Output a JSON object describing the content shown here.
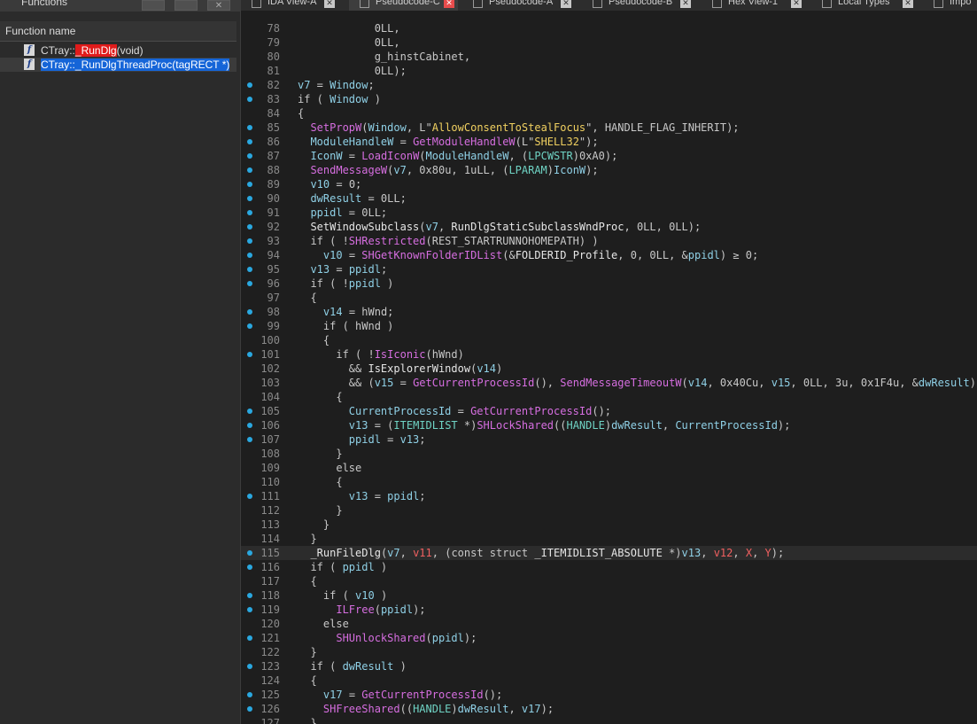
{
  "left_panel": {
    "title": "Functions",
    "header": "Function name",
    "buttons": [
      "",
      "",
      "✕"
    ],
    "items": [
      {
        "prefix": "CTray::",
        "highlight": "_RunDlg",
        "suffix": "(void)"
      },
      {
        "text": "CTray::_RunDlgThreadProc(tagRECT *)"
      }
    ]
  },
  "tabs": [
    {
      "label": "IDA View-A",
      "close": "✕"
    },
    {
      "label": "Pseudocode-C",
      "close": "✕"
    },
    {
      "label": "Pseudocode-A",
      "close": "✕"
    },
    {
      "label": "Pseudocode-B",
      "close": "✕"
    },
    {
      "label": "Hex View-1",
      "close": "✕"
    },
    {
      "label": "Local Types",
      "close": "✕"
    },
    {
      "label": "Impo"
    }
  ],
  "colors": {
    "background": "#1e1e1e",
    "line_dot": "#2aa8e0",
    "variable": "#8fd0e6",
    "function": "#d66ee0",
    "string": "#f0d060",
    "register": "#f06060",
    "type": "#6fd3c4"
  },
  "code_lines": [
    {
      "n": "78",
      "dot": false,
      "code": [
        [
          "            0LL,",
          "k"
        ]
      ]
    },
    {
      "n": "79",
      "dot": false,
      "code": [
        [
          "            0LL,",
          "k"
        ]
      ]
    },
    {
      "n": "80",
      "dot": false,
      "code": [
        [
          "            g_hinstCabinet,",
          "k"
        ]
      ]
    },
    {
      "n": "81",
      "dot": false,
      "code": [
        [
          "            0LL);",
          "k"
        ]
      ]
    },
    {
      "n": "82",
      "dot": true,
      "code": [
        [
          "v7",
          "v"
        ],
        [
          " = ",
          "k"
        ],
        [
          "Window",
          "v"
        ],
        [
          ";",
          "k"
        ]
      ]
    },
    {
      "n": "83",
      "dot": true,
      "code": [
        [
          "if ( ",
          "k"
        ],
        [
          "Window",
          "v"
        ],
        [
          " )",
          "k"
        ]
      ]
    },
    {
      "n": "84",
      "dot": false,
      "code": [
        [
          "{",
          "k"
        ]
      ]
    },
    {
      "n": "85",
      "dot": true,
      "code": [
        [
          "  ",
          "k"
        ],
        [
          "SetPropW",
          "f"
        ],
        [
          "(",
          "k"
        ],
        [
          "Window",
          "v"
        ],
        [
          ", L\"",
          "k"
        ],
        [
          "AllowConsentToStealFocus",
          "s"
        ],
        [
          "\", HANDLE_FLAG_INHERIT);",
          "k"
        ]
      ]
    },
    {
      "n": "86",
      "dot": true,
      "code": [
        [
          "  ",
          "k"
        ],
        [
          "ModuleHandleW",
          "v"
        ],
        [
          " = ",
          "k"
        ],
        [
          "GetModuleHandleW",
          "f"
        ],
        [
          "(L\"",
          "k"
        ],
        [
          "SHELL32",
          "s"
        ],
        [
          "\");",
          "k"
        ]
      ]
    },
    {
      "n": "87",
      "dot": true,
      "code": [
        [
          "  ",
          "k"
        ],
        [
          "IconW",
          "v"
        ],
        [
          " = ",
          "k"
        ],
        [
          "LoadIconW",
          "f"
        ],
        [
          "(",
          "k"
        ],
        [
          "ModuleHandleW",
          "v"
        ],
        [
          ", (",
          "k"
        ],
        [
          "LPCWSTR",
          "ty"
        ],
        [
          ")0xA0);",
          "k"
        ]
      ]
    },
    {
      "n": "88",
      "dot": true,
      "code": [
        [
          "  ",
          "k"
        ],
        [
          "SendMessageW",
          "f"
        ],
        [
          "(",
          "k"
        ],
        [
          "v7",
          "v"
        ],
        [
          ", 0x80u, 1uLL, (",
          "k"
        ],
        [
          "LPARAM",
          "ty"
        ],
        [
          ")",
          "k"
        ],
        [
          "IconW",
          "v"
        ],
        [
          ");",
          "k"
        ]
      ]
    },
    {
      "n": "89",
      "dot": true,
      "code": [
        [
          "  ",
          "k"
        ],
        [
          "v10",
          "v"
        ],
        [
          " = 0;",
          "k"
        ]
      ]
    },
    {
      "n": "90",
      "dot": true,
      "code": [
        [
          "  ",
          "k"
        ],
        [
          "dwResult",
          "v"
        ],
        [
          " = 0LL;",
          "k"
        ]
      ]
    },
    {
      "n": "91",
      "dot": true,
      "code": [
        [
          "  ",
          "k"
        ],
        [
          "ppidl",
          "v"
        ],
        [
          " = 0LL;",
          "k"
        ]
      ]
    },
    {
      "n": "92",
      "dot": true,
      "code": [
        [
          "  ",
          "k"
        ],
        [
          "SetWindowSubclass",
          "fw"
        ],
        [
          "(",
          "k"
        ],
        [
          "v7",
          "v"
        ],
        [
          ", ",
          "k"
        ],
        [
          "RunDlgStaticSubclassWndProc",
          "fw"
        ],
        [
          ", 0LL, 0LL);",
          "k"
        ]
      ]
    },
    {
      "n": "93",
      "dot": true,
      "code": [
        [
          "  if ( !",
          "k"
        ],
        [
          "SHRestricted",
          "f"
        ],
        [
          "(REST_STARTRUNNOHOMEPATH) )",
          "k"
        ]
      ]
    },
    {
      "n": "94",
      "dot": true,
      "code": [
        [
          "    ",
          "k"
        ],
        [
          "v10",
          "v"
        ],
        [
          " = ",
          "k"
        ],
        [
          "SHGetKnownFolderIDList",
          "f"
        ],
        [
          "(&",
          "k"
        ],
        [
          "FOLDERID_Profile",
          "fw"
        ],
        [
          ", 0, 0LL, &",
          "k"
        ],
        [
          "ppidl",
          "v"
        ],
        [
          ") ≥ 0;",
          "k"
        ]
      ]
    },
    {
      "n": "95",
      "dot": true,
      "code": [
        [
          "  ",
          "k"
        ],
        [
          "v13",
          "v"
        ],
        [
          " = ",
          "k"
        ],
        [
          "ppidl",
          "v"
        ],
        [
          ";",
          "k"
        ]
      ]
    },
    {
      "n": "96",
      "dot": true,
      "code": [
        [
          "  if ( !",
          "k"
        ],
        [
          "ppidl",
          "v"
        ],
        [
          " )",
          "k"
        ]
      ]
    },
    {
      "n": "97",
      "dot": false,
      "code": [
        [
          "  {",
          "k"
        ]
      ]
    },
    {
      "n": "98",
      "dot": true,
      "code": [
        [
          "    ",
          "k"
        ],
        [
          "v14",
          "v"
        ],
        [
          " = hWnd;",
          "k"
        ]
      ]
    },
    {
      "n": "99",
      "dot": true,
      "code": [
        [
          "    if ( hWnd )",
          "k"
        ]
      ]
    },
    {
      "n": "100",
      "dot": false,
      "code": [
        [
          "    {",
          "k"
        ]
      ]
    },
    {
      "n": "101",
      "dot": true,
      "code": [
        [
          "      if ( !",
          "k"
        ],
        [
          "IsIconic",
          "f"
        ],
        [
          "(hWnd)",
          "k"
        ]
      ]
    },
    {
      "n": "102",
      "dot": false,
      "code": [
        [
          "        && ",
          "k"
        ],
        [
          "IsExplorerWindow",
          "fw"
        ],
        [
          "(",
          "k"
        ],
        [
          "v14",
          "v"
        ],
        [
          ")",
          "k"
        ]
      ]
    },
    {
      "n": "103",
      "dot": false,
      "code": [
        [
          "        && (",
          "k"
        ],
        [
          "v15",
          "v"
        ],
        [
          " = ",
          "k"
        ],
        [
          "GetCurrentProcessId",
          "f"
        ],
        [
          "(), ",
          "k"
        ],
        [
          "SendMessageTimeoutW",
          "f"
        ],
        [
          "(",
          "k"
        ],
        [
          "v14",
          "v"
        ],
        [
          ", 0x40Cu, ",
          "k"
        ],
        [
          "v15",
          "v"
        ],
        [
          ", 0LL, 3u, 0x1F4u, &",
          "k"
        ],
        [
          "dwResult",
          "v"
        ],
        [
          "), dw",
          "k"
        ]
      ]
    },
    {
      "n": "104",
      "dot": false,
      "code": [
        [
          "      {",
          "k"
        ]
      ]
    },
    {
      "n": "105",
      "dot": true,
      "code": [
        [
          "        ",
          "k"
        ],
        [
          "CurrentProcessId",
          "v"
        ],
        [
          " = ",
          "k"
        ],
        [
          "GetCurrentProcessId",
          "f"
        ],
        [
          "();",
          "k"
        ]
      ]
    },
    {
      "n": "106",
      "dot": true,
      "code": [
        [
          "        ",
          "k"
        ],
        [
          "v13",
          "v"
        ],
        [
          " = (",
          "k"
        ],
        [
          "ITEMIDLIST",
          "ty"
        ],
        [
          " *)",
          "k"
        ],
        [
          "SHLockShared",
          "f"
        ],
        [
          "((",
          "k"
        ],
        [
          "HANDLE",
          "ty"
        ],
        [
          ")",
          "k"
        ],
        [
          "dwResult",
          "v"
        ],
        [
          ", ",
          "k"
        ],
        [
          "CurrentProcessId",
          "v"
        ],
        [
          ");",
          "k"
        ]
      ]
    },
    {
      "n": "107",
      "dot": true,
      "code": [
        [
          "        ",
          "k"
        ],
        [
          "ppidl",
          "v"
        ],
        [
          " = ",
          "k"
        ],
        [
          "v13",
          "v"
        ],
        [
          ";",
          "k"
        ]
      ]
    },
    {
      "n": "108",
      "dot": false,
      "code": [
        [
          "      }",
          "k"
        ]
      ]
    },
    {
      "n": "109",
      "dot": false,
      "code": [
        [
          "      else",
          "k"
        ]
      ]
    },
    {
      "n": "110",
      "dot": false,
      "code": [
        [
          "      {",
          "k"
        ]
      ]
    },
    {
      "n": "111",
      "dot": true,
      "code": [
        [
          "        ",
          "k"
        ],
        [
          "v13",
          "v"
        ],
        [
          " = ",
          "k"
        ],
        [
          "ppidl",
          "v"
        ],
        [
          ";",
          "k"
        ]
      ]
    },
    {
      "n": "112",
      "dot": false,
      "code": [
        [
          "      }",
          "k"
        ]
      ]
    },
    {
      "n": "113",
      "dot": false,
      "code": [
        [
          "    }",
          "k"
        ]
      ]
    },
    {
      "n": "114",
      "dot": false,
      "code": [
        [
          "  }",
          "k"
        ]
      ]
    },
    {
      "n": "115",
      "dot": true,
      "cur": true,
      "code": [
        [
          "  ",
          "k"
        ],
        [
          "_RunFileDlg",
          "fw"
        ],
        [
          "(",
          "k"
        ],
        [
          "v7",
          "v"
        ],
        [
          ", ",
          "k"
        ],
        [
          "v11",
          "r"
        ],
        [
          ", (const struct ",
          "k"
        ],
        [
          "_ITEMIDLIST_ABSOLUTE",
          "fw"
        ],
        [
          " *)",
          "k"
        ],
        [
          "v13",
          "v"
        ],
        [
          ", ",
          "k"
        ],
        [
          "v12",
          "r"
        ],
        [
          ", ",
          "k"
        ],
        [
          "X",
          "r"
        ],
        [
          ", ",
          "k"
        ],
        [
          "Y",
          "r"
        ],
        [
          ");",
          "k"
        ]
      ]
    },
    {
      "n": "116",
      "dot": true,
      "code": [
        [
          "  if ( ",
          "k"
        ],
        [
          "ppidl",
          "v"
        ],
        [
          " )",
          "k"
        ]
      ]
    },
    {
      "n": "117",
      "dot": false,
      "code": [
        [
          "  {",
          "k"
        ]
      ]
    },
    {
      "n": "118",
      "dot": true,
      "code": [
        [
          "    if ( ",
          "k"
        ],
        [
          "v10",
          "v"
        ],
        [
          " )",
          "k"
        ]
      ]
    },
    {
      "n": "119",
      "dot": true,
      "code": [
        [
          "      ",
          "k"
        ],
        [
          "ILFree",
          "f"
        ],
        [
          "(",
          "k"
        ],
        [
          "ppidl",
          "v"
        ],
        [
          ");",
          "k"
        ]
      ]
    },
    {
      "n": "120",
      "dot": false,
      "code": [
        [
          "    else",
          "k"
        ]
      ]
    },
    {
      "n": "121",
      "dot": true,
      "code": [
        [
          "      ",
          "k"
        ],
        [
          "SHUnlockShared",
          "f"
        ],
        [
          "(",
          "k"
        ],
        [
          "ppidl",
          "v"
        ],
        [
          ");",
          "k"
        ]
      ]
    },
    {
      "n": "122",
      "dot": false,
      "code": [
        [
          "  }",
          "k"
        ]
      ]
    },
    {
      "n": "123",
      "dot": true,
      "code": [
        [
          "  if ( ",
          "k"
        ],
        [
          "dwResult",
          "v"
        ],
        [
          " )",
          "k"
        ]
      ]
    },
    {
      "n": "124",
      "dot": false,
      "code": [
        [
          "  {",
          "k"
        ]
      ]
    },
    {
      "n": "125",
      "dot": true,
      "code": [
        [
          "    ",
          "k"
        ],
        [
          "v17",
          "v"
        ],
        [
          " = ",
          "k"
        ],
        [
          "GetCurrentProcessId",
          "f"
        ],
        [
          "();",
          "k"
        ]
      ]
    },
    {
      "n": "126",
      "dot": true,
      "code": [
        [
          "    ",
          "k"
        ],
        [
          "SHFreeShared",
          "f"
        ],
        [
          "((",
          "k"
        ],
        [
          "HANDLE",
          "ty"
        ],
        [
          ")",
          "k"
        ],
        [
          "dwResult",
          "v"
        ],
        [
          ", ",
          "k"
        ],
        [
          "v17",
          "v"
        ],
        [
          ");",
          "k"
        ]
      ]
    },
    {
      "n": "127",
      "dot": false,
      "code": [
        [
          "  }",
          "k"
        ]
      ]
    }
  ]
}
